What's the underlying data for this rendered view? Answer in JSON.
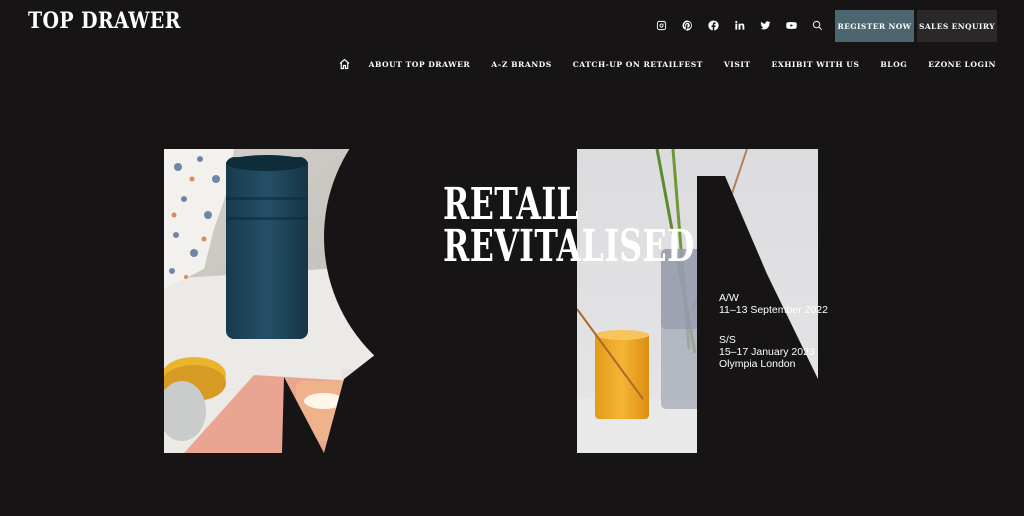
{
  "brand": {
    "logo_text": "TOP DRAWER"
  },
  "social_icons": [
    "instagram-icon",
    "pinterest-icon",
    "facebook-icon",
    "linkedin-icon",
    "twitter-icon",
    "youtube-icon",
    "search-icon"
  ],
  "header_buttons": {
    "register": "REGISTER NOW",
    "sales": "SALES ENQUIRY"
  },
  "nav": {
    "items": [
      {
        "label": "ABOUT TOP DRAWER"
      },
      {
        "label": "A–Z BRANDS"
      },
      {
        "label": "CATCH-UP ON RETAILFEST"
      },
      {
        "label": "VISIT"
      },
      {
        "label": "EXHIBIT WITH US"
      },
      {
        "label": "BLOG"
      },
      {
        "label": "EZONE LOGIN"
      }
    ]
  },
  "hero": {
    "headline_line1": "RETAIL",
    "headline_line2": "REVITALISED",
    "aw_label": "A/W",
    "aw_dates": "11–13 September 2022",
    "ss_label": "S/S",
    "ss_dates": "15–17 January 2023",
    "venue": "Olympia London"
  },
  "colors": {
    "background": "#161415",
    "register_button": "#4c6670",
    "sales_button": "#2a2829"
  }
}
